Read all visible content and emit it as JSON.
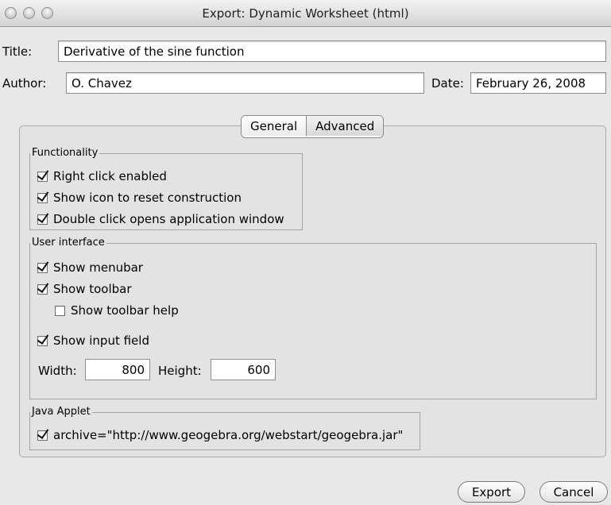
{
  "window": {
    "title": "Export: Dynamic Worksheet (html)"
  },
  "form": {
    "title_label": "Title:",
    "title_value": "Derivative of the sine function",
    "author_label": "Author:",
    "author_value": "O. Chavez",
    "date_label": "Date:",
    "date_value": "February 26, 2008"
  },
  "tabs": [
    {
      "label": "General",
      "selected": true
    },
    {
      "label": "Advanced",
      "selected": false
    }
  ],
  "functionality": {
    "label": "Functionality",
    "items": [
      {
        "label": "Right click enabled",
        "checked": true
      },
      {
        "label": "Show icon to reset construction",
        "checked": true
      },
      {
        "label": "Double click opens application window",
        "checked": true
      }
    ]
  },
  "user_interface": {
    "label": "User interface",
    "items": [
      {
        "label": "Show menubar",
        "checked": true
      },
      {
        "label": "Show toolbar",
        "checked": true
      },
      {
        "label": "Show toolbar help",
        "checked": false
      },
      {
        "label": "Show input field",
        "checked": true
      }
    ],
    "width_label": "Width:",
    "width_value": "800",
    "height_label": "Height:",
    "height_value": "600"
  },
  "java_applet": {
    "label": "Java Applet",
    "items": [
      {
        "label": "archive=\"http://www.geogebra.org/webstart/geogebra.jar\"",
        "checked": true
      }
    ]
  },
  "buttons": {
    "export": "Export",
    "cancel": "Cancel"
  }
}
